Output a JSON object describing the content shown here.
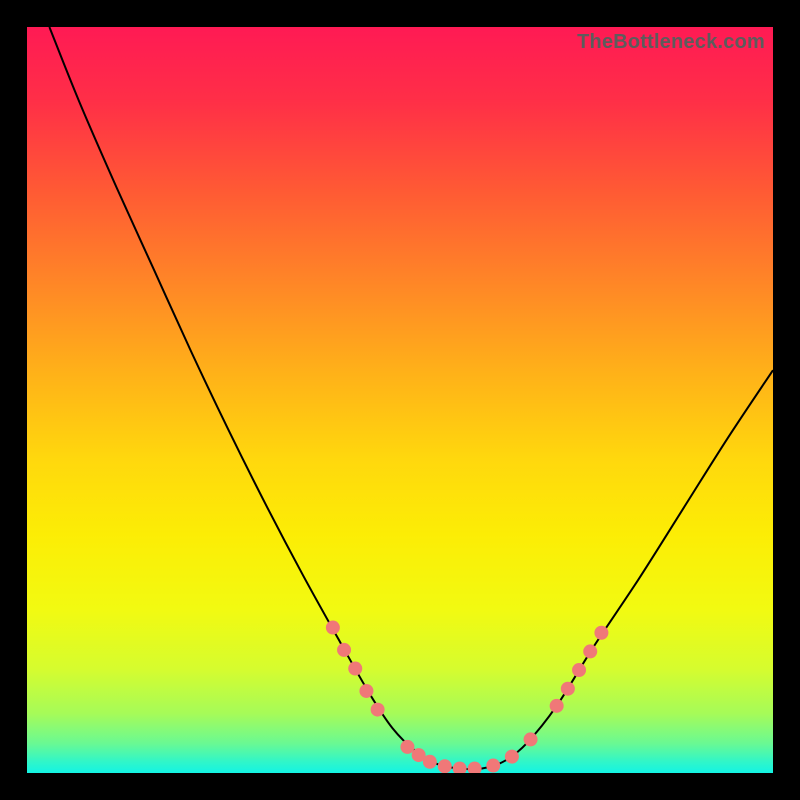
{
  "watermark": "TheBottleneck.com",
  "chart_data": {
    "type": "line",
    "title": "",
    "xlabel": "",
    "ylabel": "",
    "xlim": [
      0,
      100
    ],
    "ylim": [
      0,
      100
    ],
    "background_gradient": {
      "stops": [
        {
          "offset": 0.0,
          "color": "#ff1a54"
        },
        {
          "offset": 0.1,
          "color": "#ff2f47"
        },
        {
          "offset": 0.22,
          "color": "#ff5a34"
        },
        {
          "offset": 0.34,
          "color": "#ff8527"
        },
        {
          "offset": 0.46,
          "color": "#ffb019"
        },
        {
          "offset": 0.58,
          "color": "#ffd80d"
        },
        {
          "offset": 0.68,
          "color": "#fced05"
        },
        {
          "offset": 0.78,
          "color": "#f2fa11"
        },
        {
          "offset": 0.86,
          "color": "#d6fc2e"
        },
        {
          "offset": 0.92,
          "color": "#a6fb58"
        },
        {
          "offset": 0.96,
          "color": "#6af992"
        },
        {
          "offset": 0.985,
          "color": "#30f6c9"
        },
        {
          "offset": 1.0,
          "color": "#13f4e4"
        }
      ]
    },
    "series": [
      {
        "name": "bottleneck-curve",
        "color": "#000000",
        "x": [
          3.0,
          7.0,
          12.0,
          17.0,
          22.0,
          27.0,
          32.0,
          37.0,
          42.0,
          46.0,
          49.0,
          52.0,
          55.0,
          58.0,
          61.0,
          64.0,
          67.0,
          71.0,
          76.0,
          82.0,
          88.0,
          94.0,
          100.0
        ],
        "values": [
          100.0,
          90.0,
          78.5,
          67.5,
          56.5,
          46.0,
          36.0,
          26.5,
          17.5,
          10.5,
          6.0,
          3.0,
          1.2,
          0.6,
          0.6,
          1.6,
          4.0,
          9.0,
          17.0,
          26.0,
          35.5,
          45.0,
          54.0
        ]
      }
    ],
    "markers": {
      "name": "highlight-dots",
      "color": "#f07878",
      "radius_px": 7,
      "points": [
        {
          "x": 41.0,
          "y": 19.5
        },
        {
          "x": 42.5,
          "y": 16.5
        },
        {
          "x": 44.0,
          "y": 14.0
        },
        {
          "x": 45.5,
          "y": 11.0
        },
        {
          "x": 47.0,
          "y": 8.5
        },
        {
          "x": 51.0,
          "y": 3.5
        },
        {
          "x": 52.5,
          "y": 2.4
        },
        {
          "x": 54.0,
          "y": 1.5
        },
        {
          "x": 56.0,
          "y": 0.9
        },
        {
          "x": 58.0,
          "y": 0.6
        },
        {
          "x": 60.0,
          "y": 0.6
        },
        {
          "x": 62.5,
          "y": 1.0
        },
        {
          "x": 65.0,
          "y": 2.2
        },
        {
          "x": 67.5,
          "y": 4.5
        },
        {
          "x": 71.0,
          "y": 9.0
        },
        {
          "x": 72.5,
          "y": 11.3
        },
        {
          "x": 74.0,
          "y": 13.8
        },
        {
          "x": 75.5,
          "y": 16.3
        },
        {
          "x": 77.0,
          "y": 18.8
        }
      ]
    }
  }
}
